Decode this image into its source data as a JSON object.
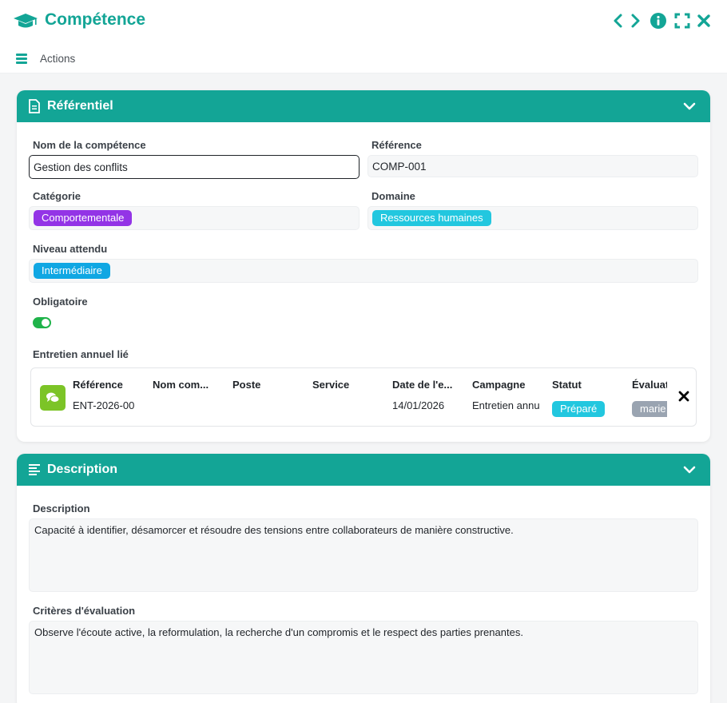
{
  "header": {
    "title": "Compétence",
    "actions_label": "Actions"
  },
  "colors": {
    "brand": "#13a596",
    "category_chip": "#9334e6",
    "domain_chip": "#22c7df",
    "level_chip": "#10a7e3",
    "status_chip": "#22c7df",
    "evaluator_chip": "#9aa4b1",
    "toggle_on": "#1fb34a",
    "linked_icon": "#7cc427"
  },
  "referentiel": {
    "section_title": "Référentiel",
    "name_label": "Nom de la compétence",
    "name_value": "Gestion des conflits",
    "reference_label": "Référence",
    "reference_value": "COMP-001",
    "category_label": "Catégorie",
    "category_value": "Comportementale",
    "domain_label": "Domaine",
    "domain_value": "Ressources humaines",
    "level_label": "Niveau attendu",
    "level_value": "Intermédiaire",
    "mandatory_label": "Obligatoire",
    "mandatory_value": true,
    "linked_label": "Entretien annuel lié",
    "linked_columns": [
      "Référence",
      "Nom com...",
      "Poste",
      "Service",
      "Date de l'e...",
      "Campagne",
      "Statut",
      "Évaluat"
    ],
    "linked_row": {
      "reference": "ENT-2026-00",
      "name": "",
      "poste": "",
      "service": "",
      "date": "14/01/2026",
      "campagne": "Entretien annu",
      "statut": "Préparé",
      "evaluateur": "marie"
    }
  },
  "description": {
    "section_title": "Description",
    "desc_label": "Description",
    "desc_value": "Capacité à identifier, désamorcer et résoudre des tensions entre collaborateurs de manière constructive.",
    "criteria_label": "Critères d'évaluation",
    "criteria_value": "Observe l'écoute active, la reformulation, la recherche d'un compromis et le respect des parties prenantes."
  },
  "icons": [
    "graduation-cap-icon",
    "chevron-left-icon",
    "chevron-right-icon",
    "info-icon",
    "expand-icon",
    "close-icon",
    "menu-icon",
    "document-icon",
    "chevron-down-icon",
    "chat-icon",
    "align-left-icon"
  ]
}
